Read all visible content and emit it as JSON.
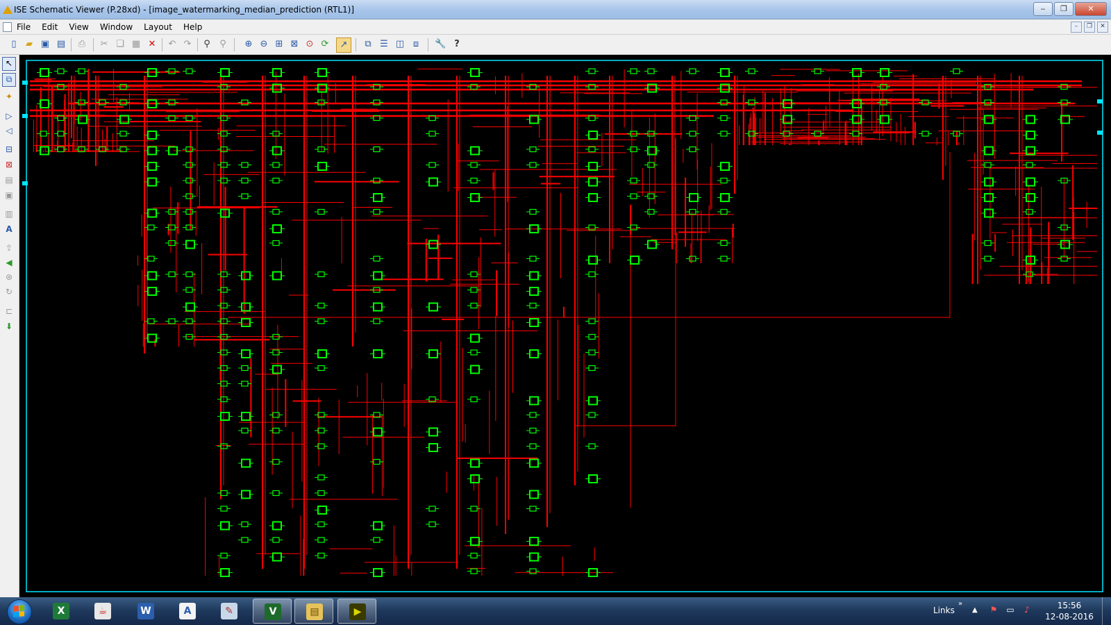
{
  "window": {
    "title": "ISE Schematic Viewer (P.28xd) - [image_watermarking_median_prediction (RTL1)]",
    "minimize_glyph": "‒",
    "maximize_glyph": "❐",
    "close_glyph": "✕"
  },
  "menu": {
    "items": [
      "File",
      "Edit",
      "View",
      "Window",
      "Layout",
      "Help"
    ]
  },
  "mdi_controls": [
    "–",
    "❐",
    "✕"
  ],
  "toolbar": {
    "icons": [
      "new-file-icon",
      "open-folder-icon",
      "save-icon",
      "save-all-icon",
      "print-icon",
      "cut-icon",
      "copy-icon",
      "paste-icon",
      "delete-icon",
      "undo-icon",
      "redo-icon",
      "find-icon",
      "find-clear-icon",
      "zoom-in-icon",
      "zoom-out-icon",
      "zoom-full-icon",
      "zoom-to-box-icon",
      "zoom-selected-icon",
      "refresh-icon",
      "select-mode-icon",
      "cascade-icon",
      "tile-horizontal-icon",
      "tile-vertical-icon",
      "arrange-icon",
      "options-wrench-icon",
      "context-help-icon"
    ]
  },
  "left_toolbar": {
    "icons": [
      "select-pointer-icon",
      "net-select-icon",
      "explore-icon",
      "forward-icon",
      "back-icon",
      "hierarchy-icon",
      "instance-icon",
      "symbol-icon",
      "block-icon",
      "text-icon",
      "label-icon",
      "push-icon",
      "go-back-icon",
      "go-forward-icon",
      "rotate-icon",
      "port-icon",
      "marker-icon"
    ]
  },
  "schematic": {
    "name": "image_watermarking_median_prediction (RTL1)",
    "background_color": "#000000",
    "wire_color": "#ff0000",
    "cell_color": "#00ff00",
    "border_color": "#00e5ff"
  },
  "taskbar": {
    "apps": [
      "excel-icon",
      "java-icon",
      "word-icon",
      "notepad-icon",
      "paint-icon",
      "vim-icon",
      "explorer-icon",
      "ise-icon"
    ],
    "active_apps": [
      5,
      6,
      7
    ],
    "links_label": "Links",
    "overflow": "»",
    "tray_up": "▲",
    "time": "15:56",
    "date": "12-08-2016"
  }
}
